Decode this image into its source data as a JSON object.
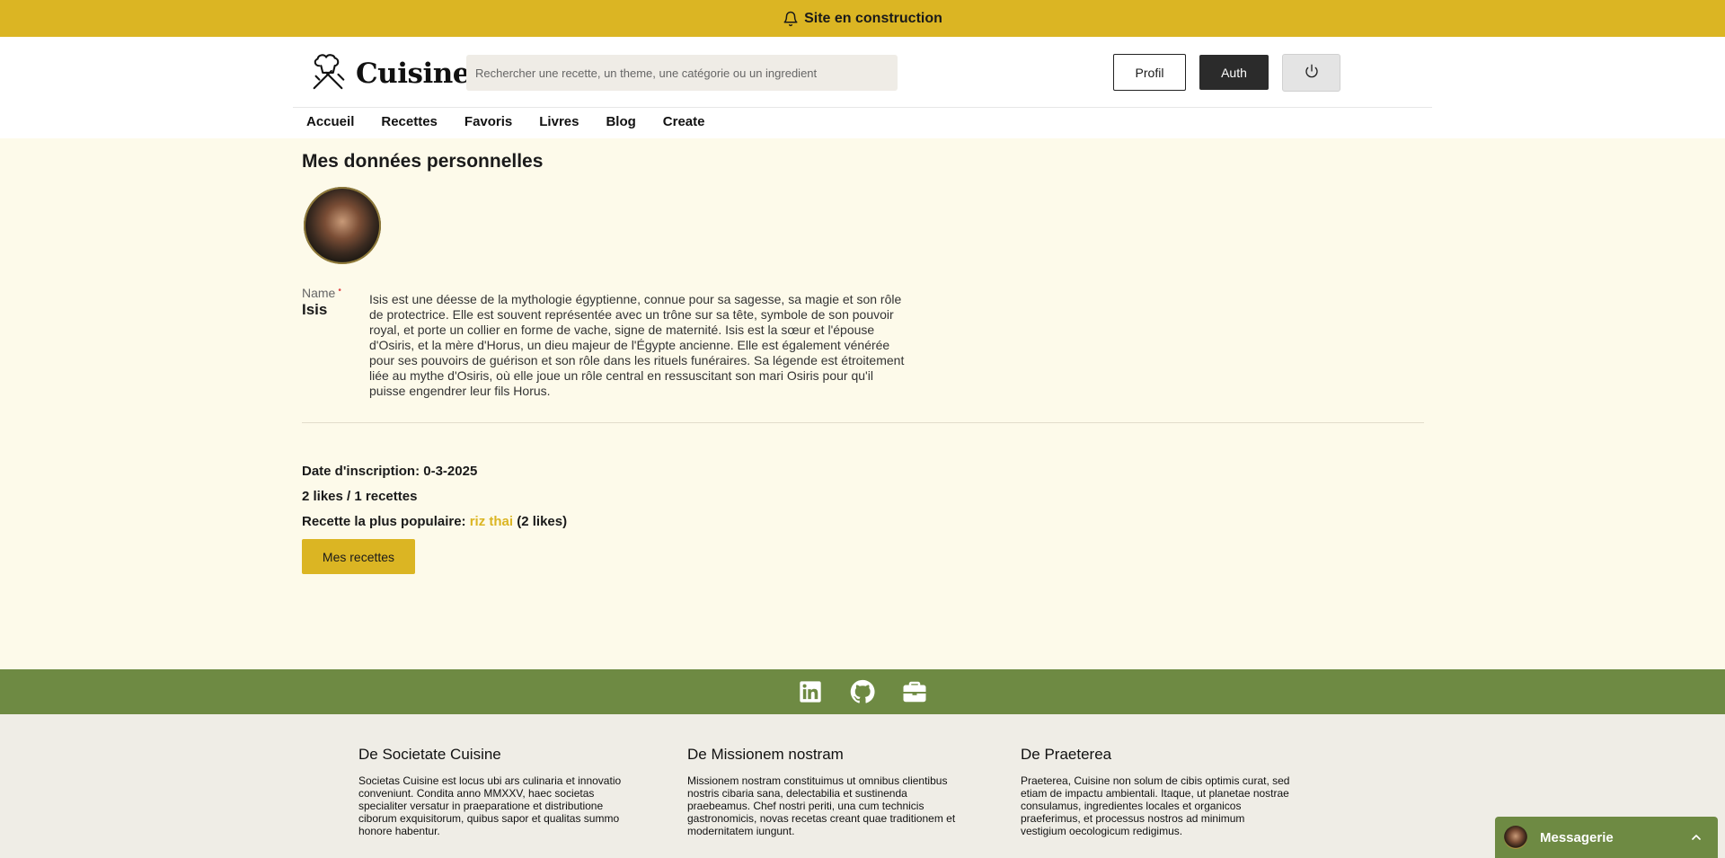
{
  "banner": {
    "text": "Site en construction",
    "icon": "bell-icon"
  },
  "header": {
    "logo_text": "Cuisine",
    "search_placeholder": "Rechercher une recette, un theme, une catégorie ou un ingredient",
    "profil_label": "Profil",
    "auth_label": "Auth",
    "power_icon": "power-icon"
  },
  "nav": {
    "items": [
      "Accueil",
      "Recettes",
      "Favoris",
      "Livres",
      "Blog",
      "Create"
    ]
  },
  "main": {
    "title": "Mes données personnelles",
    "name_label": "Name",
    "name_required": "•",
    "name_value": "Isis",
    "bio": "Isis est une déesse de la mythologie égyptienne, connue pour sa sagesse, sa magie et son rôle de protectrice. Elle est souvent représentée avec un trône sur sa tête, symbole de son pouvoir royal, et porte un collier en forme de vache, signe de maternité. Isis est la sœur et l'épouse d'Osiris, et la mère d'Horus, un dieu majeur de l'Égypte ancienne. Elle est également vénérée pour ses pouvoirs de guérison et son rôle dans les rituels funéraires. Sa légende est étroitement liée au mythe d'Osiris, où elle joue un rôle central en ressuscitant son mari Osiris pour qu'il puisse engendrer leur fils Horus.",
    "date_inscription": "Date d'inscription: 0-3-2025",
    "likes_recettes": "2 likes / 1 recettes",
    "populaire_prefix": "Recette la plus populaire:",
    "populaire_link": "riz thai",
    "populaire_suffix": "(2 likes)",
    "mes_recettes_label": "Mes recettes"
  },
  "footer": {
    "social_icons": [
      "linkedin-icon",
      "github-icon",
      "briefcase-icon"
    ],
    "columns": [
      {
        "title": "De Societate Cuisine",
        "text": "Societas Cuisine est locus ubi ars culinaria et innovatio conveniunt. Condita anno MMXXV, haec societas specialiter versatur in praeparatione et distributione ciborum exquisitorum, quibus sapor et qualitas summo honore habentur."
      },
      {
        "title": "De Missionem nostram",
        "text": "Missionem nostram constituimus ut omnibus clientibus nostris cibaria sana, delectabilia et sustinenda praebeamus. Chef nostri periti, una cum technicis gastronomicis, novas recetas creant quae traditionem et modernitatem iungunt."
      },
      {
        "title": "De Praeterea",
        "text": "Praeterea, Cuisine non solum de cibis optimis curat, sed etiam de impactu ambientali. Itaque, ut planetae nostrae consulamus, ingredientes locales et organicos praeferimus, et processus nostros ad minimum vestigium oecologicum redigimus."
      }
    ]
  },
  "messagerie": {
    "label": "Messagerie"
  },
  "colors": {
    "accent": "#dbb523",
    "footer_green": "#6e8a43",
    "page_bg": "#fdfaea"
  }
}
